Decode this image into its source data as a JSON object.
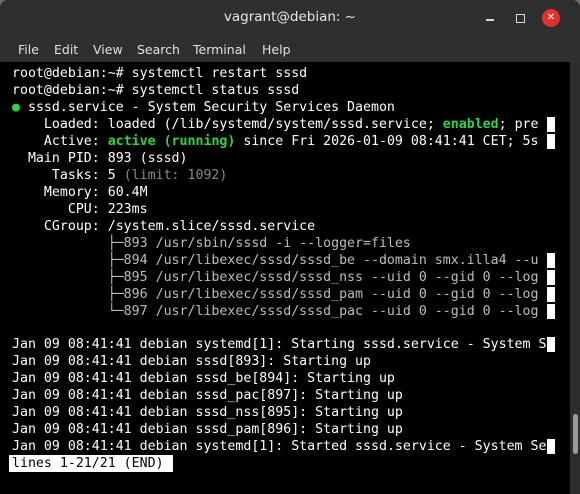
{
  "window": {
    "title": "vagrant@debian: ~",
    "close_glyph": "✕"
  },
  "menu": [
    "File",
    "Edit",
    "View",
    "Search",
    "Terminal",
    "Help"
  ],
  "terminal": {
    "cmd1": "root@debian:~# systemctl restart sssd",
    "cmd2": "root@debian:~# systemctl status sssd",
    "dot": "●",
    "service_line": " sssd.service - System Security Services Daemon",
    "loaded_label": "    Loaded: ",
    "loaded_a": "loaded (/lib/systemd/system/sssd.service; ",
    "loaded_enabled": "enabled",
    "loaded_b": "; pre",
    "active_label": "    Active: ",
    "active_state": "active (running)",
    "active_rest": " since Fri 2026-01-09 08:41:41 CET; 5s",
    "mainpid": "  Main PID: 893 (sssd)",
    "tasks_label": "     Tasks: 5 ",
    "tasks_limit": "(limit: 1092)",
    "memory": "    Memory: 60.4M",
    "cpu": "       CPU: 223ms",
    "cgroup": "    CGroup: /system.slice/sssd.service",
    "tree": [
      "            ├─893 /usr/sbin/sssd -i --logger=files",
      "            ├─894 /usr/libexec/sssd/sssd_be --domain smx.illa4 --u",
      "            ├─895 /usr/libexec/sssd/sssd_nss --uid 0 --gid 0 --log",
      "            ├─896 /usr/libexec/sssd/sssd_pam --uid 0 --gid 0 --log",
      "            └─897 /usr/libexec/sssd/sssd_pac --uid 0 --gid 0 --log"
    ],
    "logs": [
      "Jan 09 08:41:41 debian systemd[1]: Starting sssd.service - System S",
      "Jan 09 08:41:41 debian sssd[893]: Starting up",
      "Jan 09 08:41:41 debian sssd_be[894]: Starting up",
      "Jan 09 08:41:41 debian sssd_pac[897]: Starting up",
      "Jan 09 08:41:41 debian sssd_nss[895]: Starting up",
      "Jan 09 08:41:41 debian sssd_pam[896]: Starting up",
      "Jan 09 08:41:41 debian systemd[1]: Started sssd.service - System Se"
    ],
    "pager": "lines 1-21/21 (END)"
  }
}
